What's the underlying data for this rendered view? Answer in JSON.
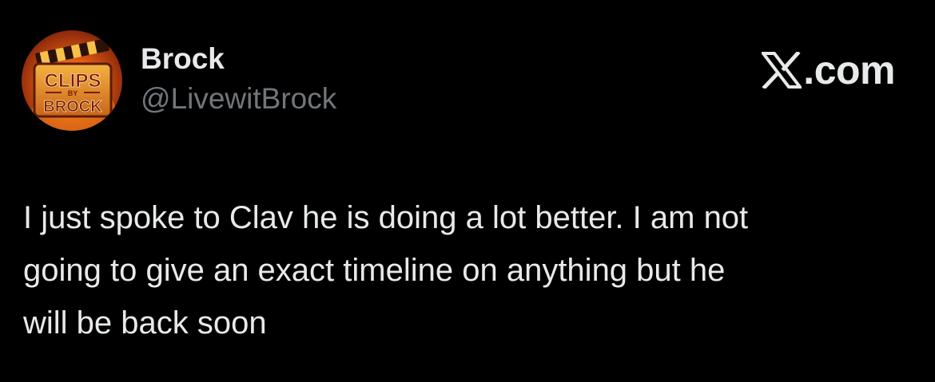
{
  "author": {
    "display_name": "Brock",
    "handle": "@LivewitBrock",
    "avatar": {
      "logo_text_top": "CLIPS",
      "logo_text_mid": "BY",
      "logo_text_bottom": "BROCK",
      "colors": [
        "#e05a12",
        "#f7b733",
        "#7a1e0a"
      ]
    }
  },
  "source": {
    "icon": "x-logo-icon",
    "domain": ".com"
  },
  "tweet": {
    "lines": [
      "I just spoke to Clav he is doing a lot better. I am not",
      "going to give an exact timeline on anything but he",
      "will be back soon"
    ]
  },
  "colors": {
    "background": "#000000",
    "primary_text": "#e7e9ea",
    "secondary_text": "#71767b"
  }
}
